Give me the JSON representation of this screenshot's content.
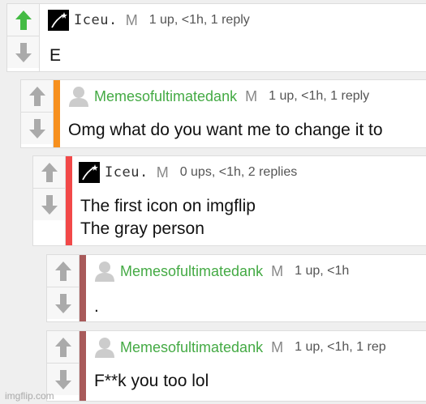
{
  "comments": [
    {
      "username": "Iceu.",
      "mod": "M",
      "meta": "1 up, <1h, 1 reply",
      "lines": [
        "E"
      ],
      "accent": "",
      "upvoted": true,
      "avatar": "iceu-avatar-icon"
    },
    {
      "username": "Memesofultimatedank",
      "mod": "M",
      "meta": "1 up, <1h, 1 reply",
      "lines": [
        "Omg what do you want me to change it to"
      ],
      "accent": "#f7901e",
      "upvoted": false,
      "avatar": "gray-person-avatar-icon"
    },
    {
      "username": "Iceu.",
      "mod": "M",
      "meta": "0 ups, <1h, 2 replies",
      "lines": [
        "The first icon on imgflip",
        "The gray person"
      ],
      "accent": "#f24848",
      "upvoted": false,
      "avatar": "iceu-avatar-icon"
    },
    {
      "username": "Memesofultimatedank",
      "mod": "M",
      "meta": "1 up, <1h",
      "lines": [
        "."
      ],
      "accent": "#a85a5a",
      "upvoted": false,
      "avatar": "gray-person-avatar-icon"
    },
    {
      "username": "Memesofultimatedank",
      "mod": "M",
      "meta": "1 up, <1h, 1 rep",
      "lines": [
        "F**k you too lol"
      ],
      "accent": "#a85a5a",
      "upvoted": false,
      "avatar": "gray-person-avatar-icon"
    }
  ],
  "watermark": "imgflip.com",
  "colors": {
    "upvote_active": "#44bb44",
    "vote_inactive": "#aaaaaa",
    "username_green": "#44aa44"
  }
}
